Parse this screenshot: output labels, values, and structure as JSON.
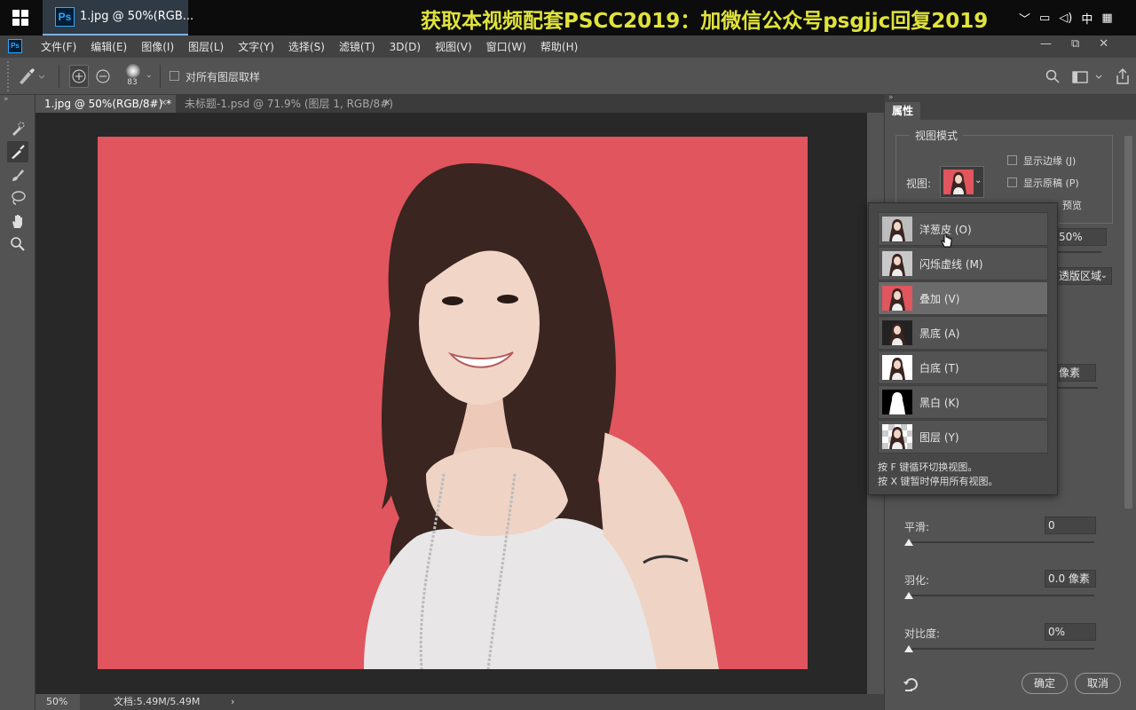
{
  "taskbar": {
    "app_title": "1.jpg @ 50%(RGB...",
    "app_icon_text": "Ps",
    "banner": "获取本视频配套PSCC2019：加微信公众号psgjjc回复2019",
    "tray": [
      "﹀",
      "▭",
      "◁)",
      "中",
      "▦"
    ]
  },
  "menubar": {
    "icon_text": "Ps",
    "items": [
      "文件(F)",
      "编辑(E)",
      "图像(I)",
      "图层(L)",
      "文字(Y)",
      "选择(S)",
      "滤镜(T)",
      "3D(D)",
      "视图(V)",
      "窗口(W)",
      "帮助(H)"
    ],
    "controls": [
      "—",
      "⧉",
      "✕"
    ]
  },
  "options": {
    "brush_size": "83",
    "sample_all_layers_label": "对所有图层取样",
    "sample_all_layers_checked": false
  },
  "tabs": [
    {
      "label": "1.jpg @ 50%(RGB/8#) *",
      "active": true
    },
    {
      "label": "未标题-1.psd @ 71.9% (图层 1, RGB/8#)",
      "active": false
    }
  ],
  "status": {
    "zoom": "50%",
    "doc_info": "文档:5.49M/5.49M",
    "arrow": "›"
  },
  "panel": {
    "title": "属性",
    "view_mode_title": "视图模式",
    "view_label": "视图:",
    "show_edge_label": "显示边缘 (J)",
    "show_original_label": "显示原稿 (P)",
    "preview_partial": "预览",
    "opacity_partial": "50%",
    "region_partial": "透版区域",
    "pixels_partial": "像素",
    "smooth_label": "平滑:",
    "smooth_value": "0",
    "feather_label": "羽化:",
    "feather_value": "0.0 像素",
    "contrast_label": "对比度:",
    "contrast_value": "0%",
    "ok_label": "确定",
    "cancel_label": "取消"
  },
  "view_dropdown": {
    "items": [
      {
        "label": "洋葱皮 (O)",
        "thumb": "onion"
      },
      {
        "label": "闪烁虚线 (M)",
        "thumb": "ants"
      },
      {
        "label": "叠加 (V)",
        "thumb": "overlay"
      },
      {
        "label": "黑底 (A)",
        "thumb": "black"
      },
      {
        "label": "白底 (T)",
        "thumb": "white"
      },
      {
        "label": "黑白 (K)",
        "thumb": "bw"
      },
      {
        "label": "图层 (Y)",
        "thumb": "layer"
      }
    ],
    "selected_index": 2,
    "note1": "按 F 键循环切换视图。",
    "note2": "按 X 键暂时停用所有视图。"
  },
  "colors": {
    "background_red": "#e0555e",
    "ps_blue": "#31a8ff",
    "banner_yellow": "#e0e33a"
  }
}
